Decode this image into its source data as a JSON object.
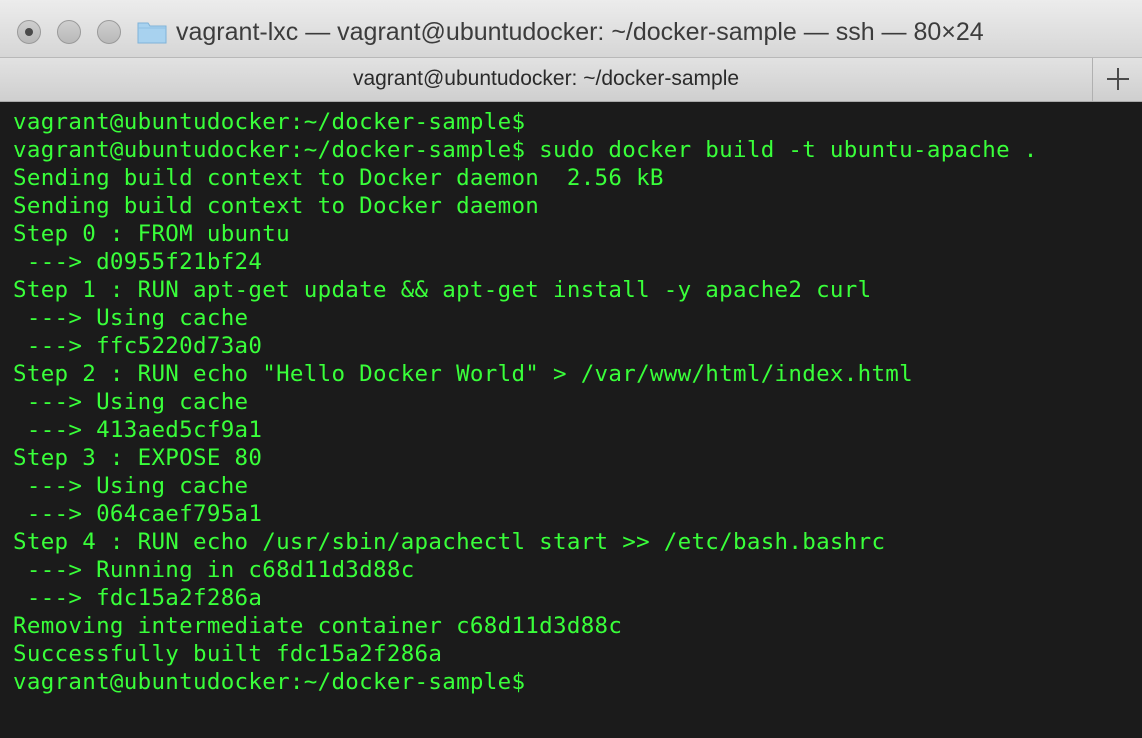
{
  "window": {
    "title": "vagrant-lxc — vagrant@ubuntudocker: ~/docker-sample — ssh — 80×24",
    "tab_title": "vagrant@ubuntudocker: ~/docker-sample"
  },
  "colors": {
    "terminal_text": "#39ff3a",
    "terminal_bg": "#1b1b1b",
    "folder": "#a8d2ef"
  },
  "icons": {
    "folder": "folder-icon",
    "new_tab": "plus-icon"
  },
  "terminal": {
    "lines": [
      "vagrant@ubuntudocker:~/docker-sample$",
      "vagrant@ubuntudocker:~/docker-sample$ sudo docker build -t ubuntu-apache .",
      "Sending build context to Docker daemon  2.56 kB",
      "Sending build context to Docker daemon",
      "Step 0 : FROM ubuntu",
      " ---> d0955f21bf24",
      "Step 1 : RUN apt-get update && apt-get install -y apache2 curl",
      " ---> Using cache",
      " ---> ffc5220d73a0",
      "Step 2 : RUN echo \"Hello Docker World\" > /var/www/html/index.html",
      " ---> Using cache",
      " ---> 413aed5cf9a1",
      "Step 3 : EXPOSE 80",
      " ---> Using cache",
      " ---> 064caef795a1",
      "Step 4 : RUN echo /usr/sbin/apachectl start >> /etc/bash.bashrc",
      " ---> Running in c68d11d3d88c",
      " ---> fdc15a2f286a",
      "Removing intermediate container c68d11d3d88c",
      "Successfully built fdc15a2f286a",
      "vagrant@ubuntudocker:~/docker-sample$"
    ]
  }
}
